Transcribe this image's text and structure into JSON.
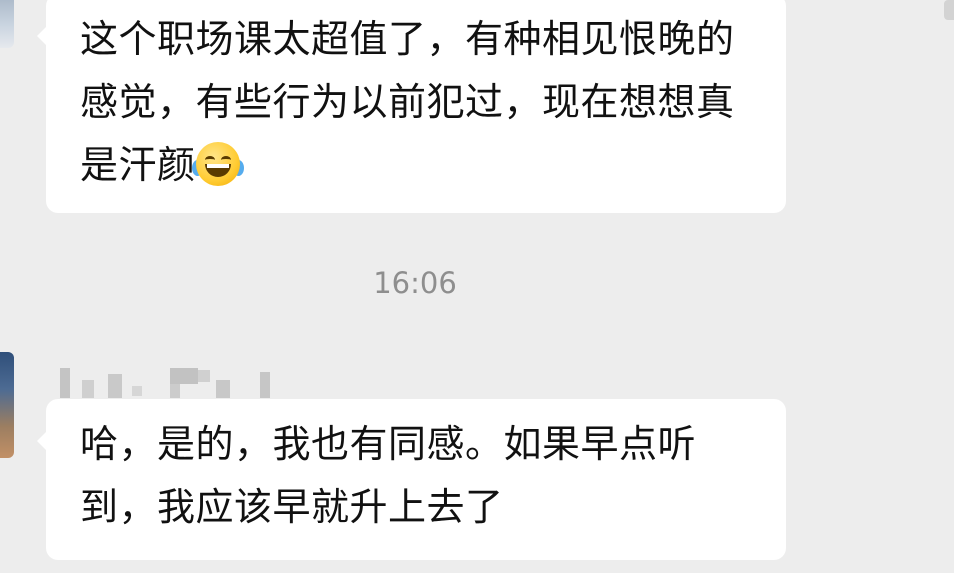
{
  "messages": [
    {
      "text": "这个职场课太超值了，有种相见恨晚的感觉，有些行为以前犯过，现在想想真是汗颜",
      "emoji": "tears-of-joy-icon"
    },
    {
      "text": "哈，是的，我也有同感。如果早点听到，我应该早就升上去了"
    }
  ],
  "timestamp": "16:06",
  "colors": {
    "background": "#ededed",
    "bubble": "#ffffff",
    "text": "#111111",
    "timestamp": "#8e8e8e"
  }
}
